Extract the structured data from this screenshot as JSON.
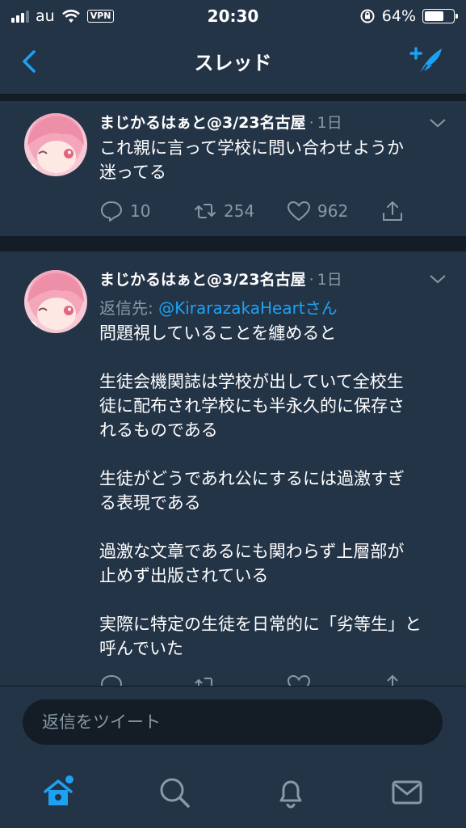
{
  "status_bar": {
    "carrier": "au",
    "vpn": "VPN",
    "time": "20:30",
    "battery": "64%"
  },
  "nav": {
    "title": "スレッド",
    "back_icon": "chevron-left-icon",
    "compose_icon": "compose-tweet-icon"
  },
  "tweets": [
    {
      "name": "まじかるはぁと@3/23名古屋",
      "dot": "·",
      "time": "1日",
      "text": "これ親に言って学校に問い合わせようか\n迷ってる",
      "replies": "10",
      "retweets": "254",
      "likes": "962"
    },
    {
      "name": "まじかるはぁと@3/23名古屋",
      "dot": "·",
      "time": "1日",
      "reply_prefix": "返信先: ",
      "reply_handle": "@KirarazakaHeartさん",
      "text": "問題視していることを纏めると\n\n生徒会機関誌は学校が出していて全校生\n徒に配布され学校にも半永久的に保存さ\nれるものである\n\n生徒がどうであれ公にするには過激すぎ\nる表現である\n\n過激な文章であるにも関わらず上層部が\n止めず出版されている\n\n実際に特定の生徒を日常的に「劣等生」と\n呼んでいた"
    }
  ],
  "compose": {
    "placeholder": "返信をツイート"
  },
  "tabbar": {
    "items": [
      "home-icon",
      "search-icon",
      "notifications-icon",
      "messages-icon"
    ]
  },
  "colors": {
    "accent": "#1da1f2",
    "background": "#141d26",
    "card": "#243447",
    "muted": "#8899a6"
  }
}
